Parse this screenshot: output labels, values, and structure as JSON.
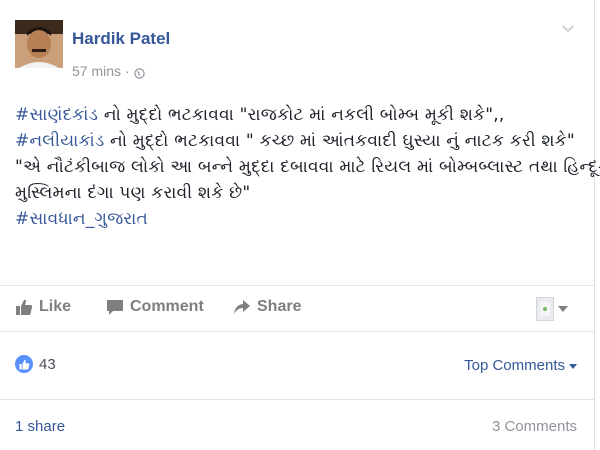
{
  "post": {
    "author": "Hardik Patel",
    "time": "57 mins",
    "separator": "·",
    "privacy_icon": "globe-icon",
    "options_icon": "chevron-down-icon",
    "content": {
      "line1_tag": "#સાણંદકાંડ",
      "line1_text": " નો મુદ્દો ભટકાવવા \"રાજકોટ માં નકલી બોમ્બ મૂકી શકે\",,",
      "line2_tag": "#નલીયાકાંડ",
      "line2_text": " નો મુદ્દો ભટકાવવા \" કચ્છ માં આંતકવાદી ઘુસ્યા નું નાટક કરી શકે\"",
      "line3": "\"એ નૌટંકીબાજ લોકો આ બન્ને મુદ્દા દબાવવા માટે રિયલ માં બોમ્બબ્લાસ્ટ તથા હિન્દૂ-",
      "line4": "મુસ્લિમના દંગા પણ કરાવી શકે છે\"",
      "line5_tag": "#સાવધાન_ગુજરાત"
    }
  },
  "actions": {
    "like_label": "Like",
    "comment_label": "Comment",
    "share_label": "Share"
  },
  "stats": {
    "likes": "43",
    "top_comments_label": "Top Comments",
    "shares": "1 share",
    "comments": "3 Comments"
  },
  "colors": {
    "link": "#365899",
    "muted": "#90949c",
    "like_blue": "#5890ff"
  }
}
